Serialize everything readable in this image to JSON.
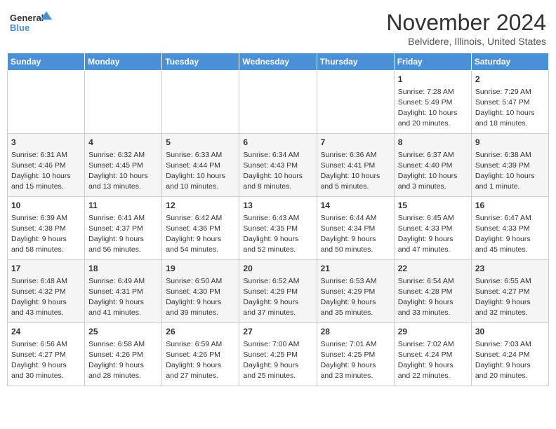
{
  "logo": {
    "line1": "General",
    "line2": "Blue"
  },
  "title": "November 2024",
  "subtitle": "Belvidere, Illinois, United States",
  "days_of_week": [
    "Sunday",
    "Monday",
    "Tuesday",
    "Wednesday",
    "Thursday",
    "Friday",
    "Saturday"
  ],
  "weeks": [
    [
      {
        "day": "",
        "info": ""
      },
      {
        "day": "",
        "info": ""
      },
      {
        "day": "",
        "info": ""
      },
      {
        "day": "",
        "info": ""
      },
      {
        "day": "",
        "info": ""
      },
      {
        "day": "1",
        "info": "Sunrise: 7:28 AM\nSunset: 5:49 PM\nDaylight: 10 hours\nand 20 minutes."
      },
      {
        "day": "2",
        "info": "Sunrise: 7:29 AM\nSunset: 5:47 PM\nDaylight: 10 hours\nand 18 minutes."
      }
    ],
    [
      {
        "day": "3",
        "info": "Sunrise: 6:31 AM\nSunset: 4:46 PM\nDaylight: 10 hours\nand 15 minutes."
      },
      {
        "day": "4",
        "info": "Sunrise: 6:32 AM\nSunset: 4:45 PM\nDaylight: 10 hours\nand 13 minutes."
      },
      {
        "day": "5",
        "info": "Sunrise: 6:33 AM\nSunset: 4:44 PM\nDaylight: 10 hours\nand 10 minutes."
      },
      {
        "day": "6",
        "info": "Sunrise: 6:34 AM\nSunset: 4:43 PM\nDaylight: 10 hours\nand 8 minutes."
      },
      {
        "day": "7",
        "info": "Sunrise: 6:36 AM\nSunset: 4:41 PM\nDaylight: 10 hours\nand 5 minutes."
      },
      {
        "day": "8",
        "info": "Sunrise: 6:37 AM\nSunset: 4:40 PM\nDaylight: 10 hours\nand 3 minutes."
      },
      {
        "day": "9",
        "info": "Sunrise: 6:38 AM\nSunset: 4:39 PM\nDaylight: 10 hours\nand 1 minute."
      }
    ],
    [
      {
        "day": "10",
        "info": "Sunrise: 6:39 AM\nSunset: 4:38 PM\nDaylight: 9 hours\nand 58 minutes."
      },
      {
        "day": "11",
        "info": "Sunrise: 6:41 AM\nSunset: 4:37 PM\nDaylight: 9 hours\nand 56 minutes."
      },
      {
        "day": "12",
        "info": "Sunrise: 6:42 AM\nSunset: 4:36 PM\nDaylight: 9 hours\nand 54 minutes."
      },
      {
        "day": "13",
        "info": "Sunrise: 6:43 AM\nSunset: 4:35 PM\nDaylight: 9 hours\nand 52 minutes."
      },
      {
        "day": "14",
        "info": "Sunrise: 6:44 AM\nSunset: 4:34 PM\nDaylight: 9 hours\nand 50 minutes."
      },
      {
        "day": "15",
        "info": "Sunrise: 6:45 AM\nSunset: 4:33 PM\nDaylight: 9 hours\nand 47 minutes."
      },
      {
        "day": "16",
        "info": "Sunrise: 6:47 AM\nSunset: 4:33 PM\nDaylight: 9 hours\nand 45 minutes."
      }
    ],
    [
      {
        "day": "17",
        "info": "Sunrise: 6:48 AM\nSunset: 4:32 PM\nDaylight: 9 hours\nand 43 minutes."
      },
      {
        "day": "18",
        "info": "Sunrise: 6:49 AM\nSunset: 4:31 PM\nDaylight: 9 hours\nand 41 minutes."
      },
      {
        "day": "19",
        "info": "Sunrise: 6:50 AM\nSunset: 4:30 PM\nDaylight: 9 hours\nand 39 minutes."
      },
      {
        "day": "20",
        "info": "Sunrise: 6:52 AM\nSunset: 4:29 PM\nDaylight: 9 hours\nand 37 minutes."
      },
      {
        "day": "21",
        "info": "Sunrise: 6:53 AM\nSunset: 4:29 PM\nDaylight: 9 hours\nand 35 minutes."
      },
      {
        "day": "22",
        "info": "Sunrise: 6:54 AM\nSunset: 4:28 PM\nDaylight: 9 hours\nand 33 minutes."
      },
      {
        "day": "23",
        "info": "Sunrise: 6:55 AM\nSunset: 4:27 PM\nDaylight: 9 hours\nand 32 minutes."
      }
    ],
    [
      {
        "day": "24",
        "info": "Sunrise: 6:56 AM\nSunset: 4:27 PM\nDaylight: 9 hours\nand 30 minutes."
      },
      {
        "day": "25",
        "info": "Sunrise: 6:58 AM\nSunset: 4:26 PM\nDaylight: 9 hours\nand 28 minutes."
      },
      {
        "day": "26",
        "info": "Sunrise: 6:59 AM\nSunset: 4:26 PM\nDaylight: 9 hours\nand 27 minutes."
      },
      {
        "day": "27",
        "info": "Sunrise: 7:00 AM\nSunset: 4:25 PM\nDaylight: 9 hours\nand 25 minutes."
      },
      {
        "day": "28",
        "info": "Sunrise: 7:01 AM\nSunset: 4:25 PM\nDaylight: 9 hours\nand 23 minutes."
      },
      {
        "day": "29",
        "info": "Sunrise: 7:02 AM\nSunset: 4:24 PM\nDaylight: 9 hours\nand 22 minutes."
      },
      {
        "day": "30",
        "info": "Sunrise: 7:03 AM\nSunset: 4:24 PM\nDaylight: 9 hours\nand 20 minutes."
      }
    ]
  ]
}
